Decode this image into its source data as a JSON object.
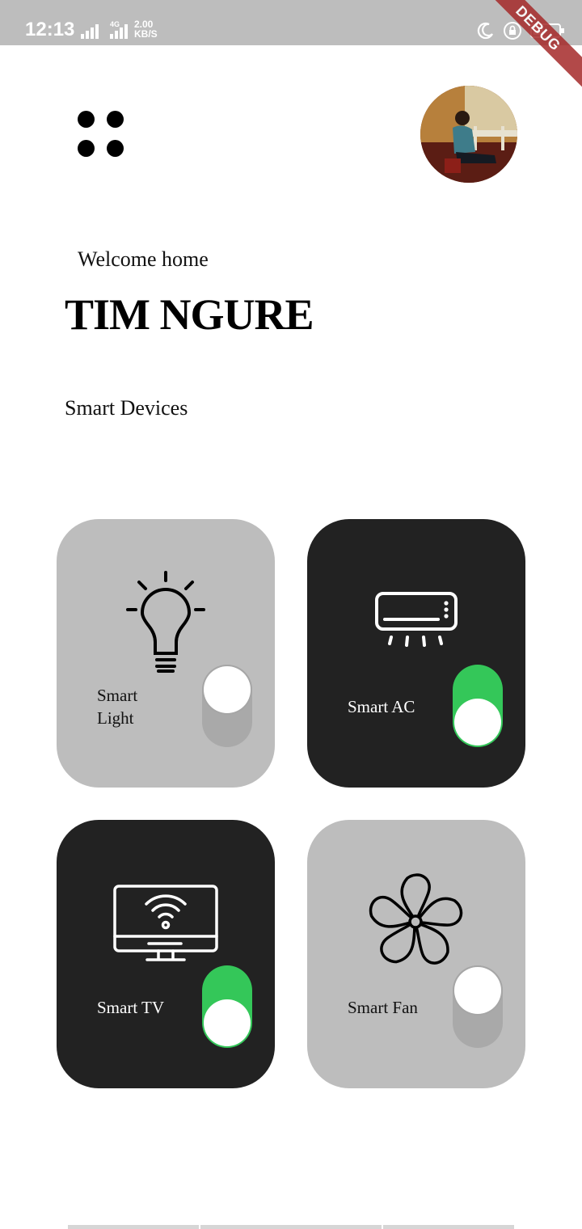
{
  "status_bar": {
    "time": "12:13",
    "speed_value": "2.00",
    "speed_unit": "KB/S",
    "network": "4G",
    "icons": [
      "signal-icon",
      "signal-4g-icon",
      "moon-icon",
      "lock-rotation-icon",
      "battery-icon"
    ]
  },
  "debug_label": "DEBUG",
  "header": {
    "menu_icon": "four-dots-menu-icon",
    "avatar_icon": "user-avatar"
  },
  "welcome": "Welcome home",
  "user_name": "TIM NGURE",
  "section_title": "Smart Devices",
  "devices": [
    {
      "label": "Smart Light",
      "icon": "light-bulb-icon",
      "on": false,
      "theme": "light"
    },
    {
      "label": "Smart AC",
      "icon": "air-conditioner-icon",
      "on": true,
      "theme": "dark"
    },
    {
      "label": "Smart TV",
      "icon": "smart-tv-icon",
      "on": true,
      "theme": "dark"
    },
    {
      "label": "Smart Fan",
      "icon": "fan-icon",
      "on": false,
      "theme": "light"
    }
  ],
  "colors": {
    "light_card": "#bdbdbd",
    "dark_card": "#222222",
    "toggle_on": "#34c759",
    "toggle_off": "#a9a9a9",
    "status_bar": "#bdbdbd"
  }
}
